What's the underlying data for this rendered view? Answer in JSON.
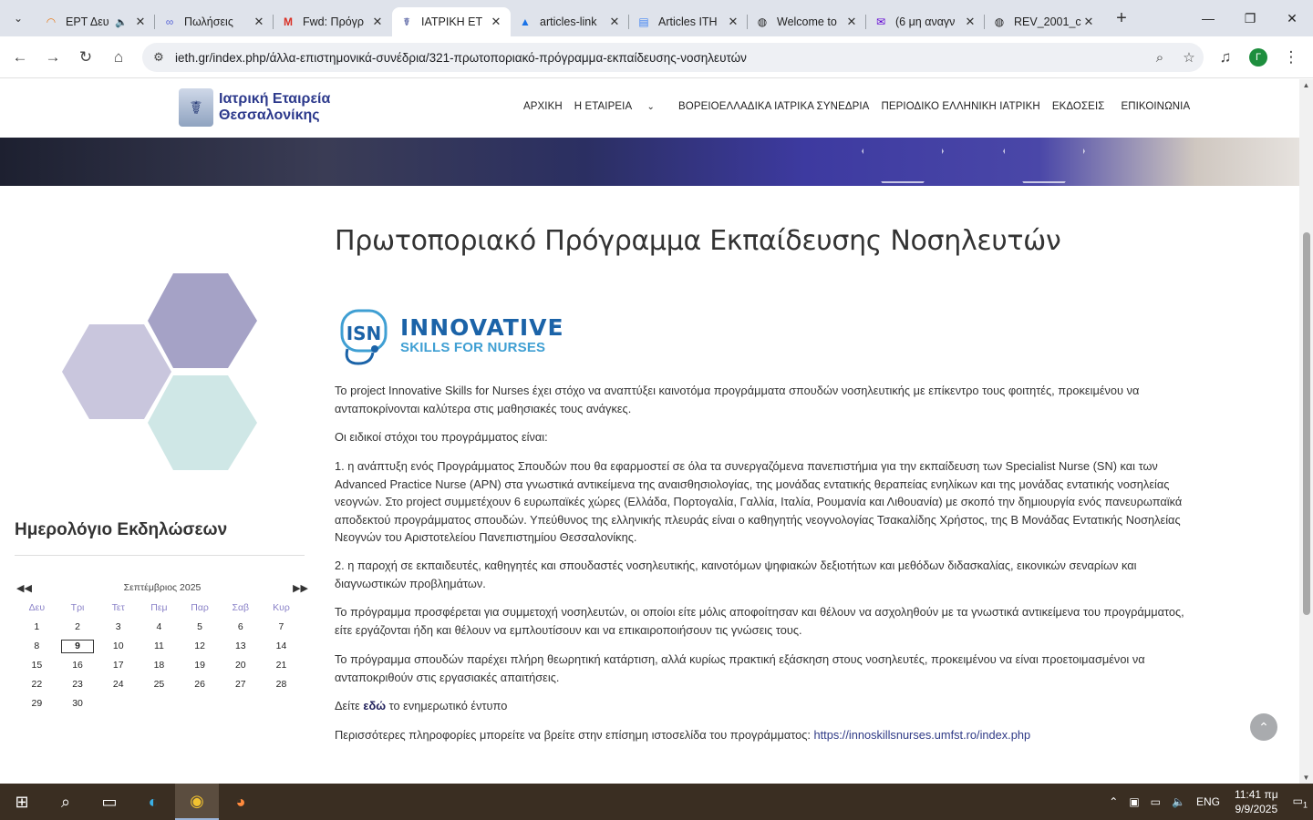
{
  "browser": {
    "tabs": [
      {
        "title": "ΕΡΤ Δευ",
        "icon": "rss-icon",
        "muted_icon": "speaker-icon"
      },
      {
        "title": "Πωλήσεις",
        "icon": "link-icon"
      },
      {
        "title": "Fwd: Πρόγρ",
        "icon": "gmail-icon"
      },
      {
        "title": "ΙΑΤΡΙΚΗ ΕΤ",
        "icon": "site-icon",
        "active": true
      },
      {
        "title": "articles-link",
        "icon": "drive-icon"
      },
      {
        "title": "Articles ITH",
        "icon": "docs-icon"
      },
      {
        "title": "Welcome to",
        "icon": "globe-icon"
      },
      {
        "title": "(6 μη αναγν",
        "icon": "mail-icon"
      },
      {
        "title": "REV_2001_c",
        "icon": "globe-icon"
      }
    ],
    "url": "ieth.gr/index.php/άλλα-επιστημονικά-συνέδρια/321-πρωτοποριακό-πρόγραμμα-εκπαίδευσης-νοσηλευτών",
    "profile_initial": "Γ"
  },
  "site": {
    "logo_line1": "Ιατρική Εταιρεία",
    "logo_line2": "Θεσσαλονίκης",
    "nav": [
      "ΑΡΧΙΚΗ",
      "Η ΕΤΑΙΡΕΙΑ",
      "ΒΟΡΕΙΟΕΛΛΑΔΙΚΑ ΙΑΤΡΙΚΑ ΣΥΝΕΔΡΙΑ",
      "ΠΕΡΙΟΔΙΚΟ ΕΛΛΗΝΙΚΗ ΙΑΤΡΙΚΗ",
      "ΕΚΔΟΣΕΙΣ",
      "ΕΠΙΚΟΙΝΩΝΙΑ"
    ]
  },
  "calendar": {
    "title": "Ημερολόγιο Εκδηλώσεων",
    "month": "Σεπτέμβριος 2025",
    "prev": "◀◀ ◀",
    "next": "▶ ▶▶",
    "weekdays": [
      "Δευ",
      "Τρι",
      "Τετ",
      "Πεμ",
      "Παρ",
      "Σαβ",
      "Κυρ"
    ],
    "days": [
      "1",
      "2",
      "3",
      "4",
      "5",
      "6",
      "7",
      "8",
      "9",
      "10",
      "11",
      "12",
      "13",
      "14",
      "15",
      "16",
      "17",
      "18",
      "19",
      "20",
      "21",
      "22",
      "23",
      "24",
      "25",
      "26",
      "27",
      "28",
      "29",
      "30"
    ],
    "today": "9"
  },
  "article": {
    "title": "Πρωτοποριακό Πρόγραμμα Εκπαίδευσης Νοσηλευτών",
    "logo_word1": "INNOVATIVE",
    "logo_word2": "SKILLS FOR NURSES",
    "logo_mark": "ISN",
    "p1": "Το project Innovative Skills for Nurses έχει στόχο να αναπτύξει καινοτόμα προγράμματα σπουδών νοσηλευτικής με επίκεντρο τους φοιτητές, προκειμένου να ανταποκρίνονται καλύτερα στις μαθησιακές τους ανάγκες.",
    "p2": "Οι ειδικοί στόχοι του προγράμματος είναι:",
    "p3": "1. η ανάπτυξη ενός Προγράμματος Σπουδών που θα εφαρμοστεί σε όλα τα συνεργαζόμενα πανεπιστήμια για την εκπαίδευση των Specialist Nurse (SN) και των Advanced Practice Nurse (APN) στα γνωστικά αντικείμενα της αναισθησιολογίας, της μονάδας εντατικής θεραπείας ενηλίκων και της μονάδας εντατικής νοσηλείας νεογνών. Στο project συμμετέχουν 6 ευρωπαϊκές χώρες (Ελλάδα, Πορτογαλία, Γαλλία, Ιταλία, Ρουμανία και Λιθουανία) με σκοπό την δημιουργία ενός πανευρωπαϊκά αποδεκτού προγράμματος σπουδών. Υπεύθυνος της ελληνικής πλευράς είναι ο καθηγητής νεογνολογίας Τσακαλίδης Χρήστος, της Β Μονάδας Εντατικής Νοσηλείας Νεογνών του Αριστοτελείου Πανεπιστημίου Θεσσαλονίκης.",
    "p4": "2. η παροχή σε εκπαιδευτές, καθηγητές και σπουδαστές νοσηλευτικής, καινοτόμων ψηφιακών δεξιοτήτων και μεθόδων διδασκαλίας, εικονικών σεναρίων και διαγνωστικών προβλημάτων.",
    "p5": "Το πρόγραμμα προσφέρεται για συμμετοχή νοσηλευτών, οι οποίοι είτε μόλις αποφοίτησαν και θέλουν να ασχοληθούν με τα γνωστικά αντικείμενα του προγράμματος, είτε εργάζονται ήδη και θέλουν να εμπλουτίσουν και να επικαιροποιήσουν τις γνώσεις τους.",
    "p6": "Το πρόγραμμα σπουδών παρέχει πλήρη θεωρητική κατάρτιση, αλλά κυρίως πρακτική εξάσκηση στους νοσηλευτές, προκειμένου να είναι προετοιμασμένοι να ανταποκριθούν στις εργασιακές απαιτήσεις.",
    "p7_pre": "Δείτε",
    "p7_link": "εδώ",
    "p7_post": "το ενημερωτικό έντυπο",
    "p8_pre": "Περισσότερες πληροφορίες μπορείτε να βρείτε στην επίσημη ιστοσελίδα του προγράμματος:",
    "p8_link": "https://innoskillsnurses.umfst.ro/index.php"
  },
  "taskbar": {
    "lang": "ENG",
    "time": "11:41 πμ",
    "date": "9/9/2025",
    "notifications": "1"
  },
  "colors": {
    "hex1": "#a5a2c6",
    "hex2": "#c9c6dd",
    "hex3": "#cfe7e6",
    "accent": "#2d3a8c"
  }
}
